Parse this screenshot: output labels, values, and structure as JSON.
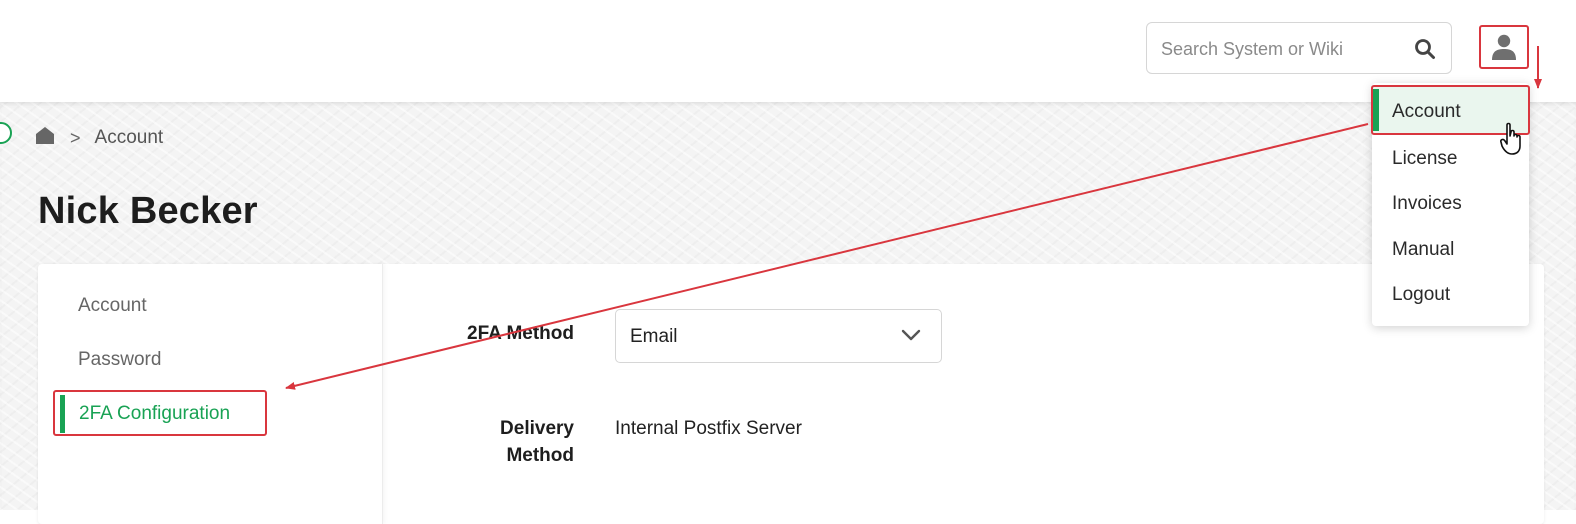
{
  "header": {
    "search": {
      "placeholder": "Search System or Wiki",
      "icon": "search-icon"
    },
    "user_button": {
      "icon": "user-icon"
    }
  },
  "breadcrumb": {
    "home_icon": "home-icon",
    "separator": ">",
    "current": "Account"
  },
  "page": {
    "title": "Nick Becker"
  },
  "sidebar": {
    "items": [
      {
        "label": "Account",
        "active": false
      },
      {
        "label": "Password",
        "active": false
      },
      {
        "label": "2FA Configuration",
        "active": true
      }
    ]
  },
  "form": {
    "method_label": "2FA Method",
    "method_value": "Email",
    "delivery_label": "Delivery Method",
    "delivery_value": "Internal Postfix Server"
  },
  "user_menu": {
    "items": [
      {
        "label": "Account",
        "active": true
      },
      {
        "label": "License"
      },
      {
        "label": "Invoices"
      },
      {
        "label": "Manual"
      },
      {
        "label": "Logout"
      }
    ]
  },
  "colors": {
    "accent_green": "#19a254",
    "annotation_red": "#d9363e",
    "background_pattern": "#f4f4f4"
  }
}
